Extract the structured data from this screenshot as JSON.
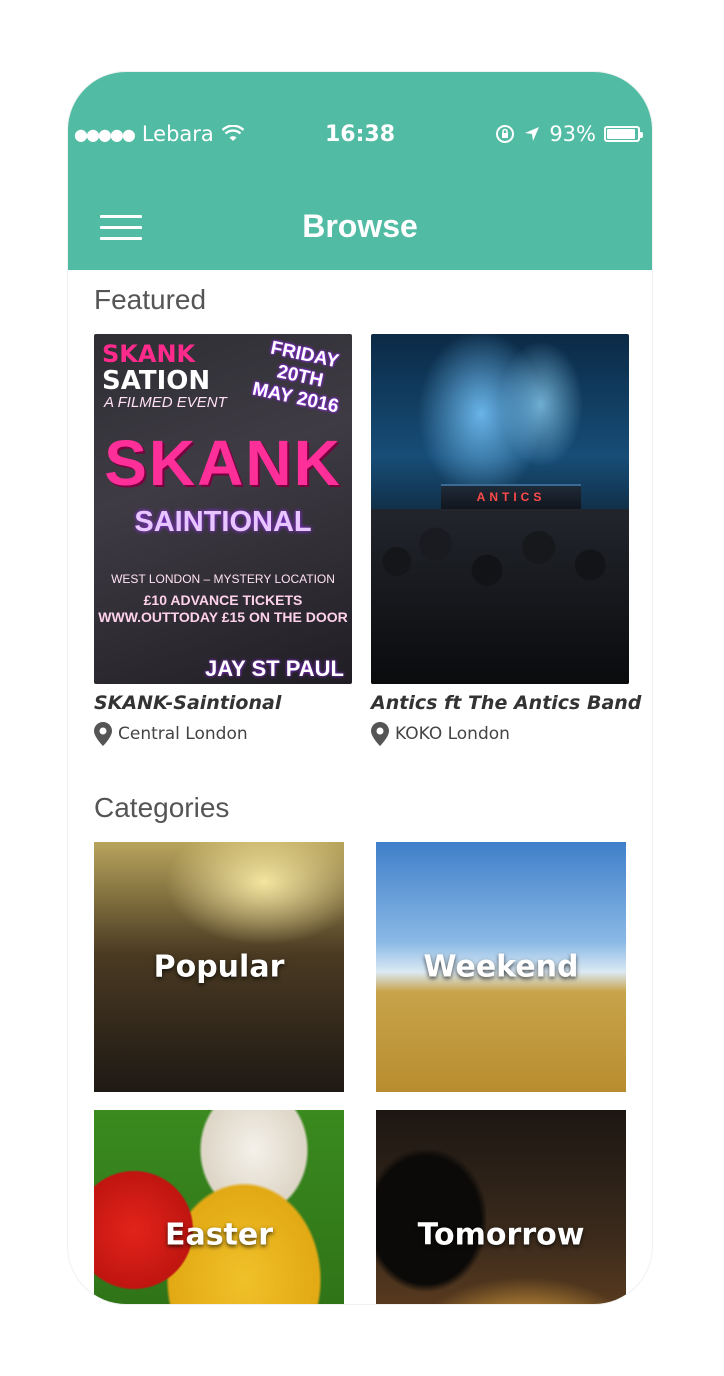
{
  "status_bar": {
    "signal": "●●●●●",
    "carrier": "Lebara",
    "time": "16:38",
    "battery": "93%",
    "battery_level": 0.93
  },
  "header": {
    "title": "Browse"
  },
  "featured": {
    "section_title": "Featured",
    "items": [
      {
        "title": "SKANK-Saintional",
        "location": "Central London",
        "poster": {
          "line1": "SKANK",
          "line2": "SATION",
          "date": "FRIDAY 20TH MAY 2016",
          "subtitle": "A FILMED EVENT",
          "headline": "SKANK",
          "subheadline": "SAINTIONAL",
          "venue_line": "WEST LONDON – MYSTERY LOCATION",
          "tickets": "£10 ADVANCE TICKETS WWW.OUTTODAY £15 ON THE DOOR",
          "artist": "JAY ST PAUL"
        }
      },
      {
        "title": "Antics ft The Antics Band",
        "location": "KOKO London",
        "poster": {
          "stage_text": "ANTICS"
        }
      }
    ]
  },
  "categories": {
    "section_title": "Categories",
    "items": [
      {
        "label": "Popular"
      },
      {
        "label": "Weekend"
      },
      {
        "label": "Easter"
      },
      {
        "label": "Tomorrow"
      }
    ]
  },
  "colors": {
    "header": "#52bba4",
    "section_title": "#555555"
  }
}
